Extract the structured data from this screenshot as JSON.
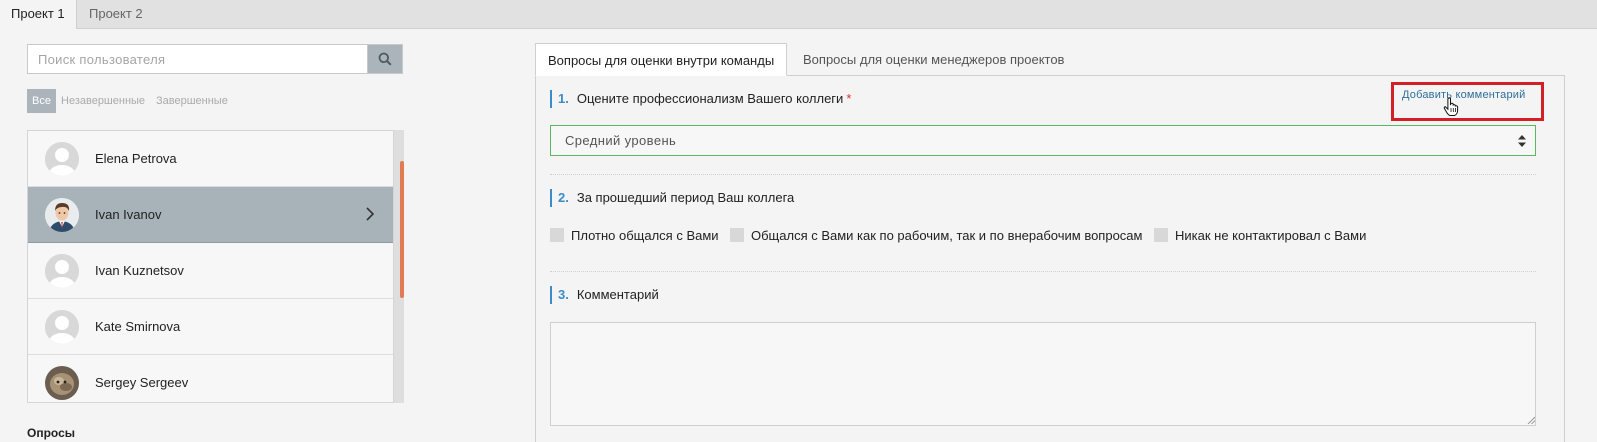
{
  "projects": {
    "tabs": [
      "Проект 1",
      "Проект 2"
    ],
    "active_index": 0
  },
  "search": {
    "placeholder": "Поиск пользователя",
    "value": "",
    "button_icon": "search-icon"
  },
  "filters": {
    "items": [
      "Все",
      "Незавершенные",
      "Завершенные"
    ],
    "active_index": 0
  },
  "users": [
    {
      "name": "Elena Petrova",
      "avatar": "default-avatar",
      "selected": false
    },
    {
      "name": "Ivan Ivanov",
      "avatar": "cartoon-man-avatar",
      "selected": true
    },
    {
      "name": "Ivan Kuznetsov",
      "avatar": "default-avatar",
      "selected": false
    },
    {
      "name": "Kate Smirnova",
      "avatar": "default-avatar",
      "selected": false
    },
    {
      "name": "Sergey Sergeev",
      "avatar": "photo-avatar",
      "selected": false
    }
  ],
  "left_section_title": "Опросы",
  "question_tabs": {
    "items": [
      "Вопросы для оценки внутри команды",
      "Вопросы для оценки менеджеров проектов"
    ],
    "active_index": 0
  },
  "questions": [
    {
      "number": "1.",
      "text": "Оцените профессионализм Вашего коллеги",
      "required": "*",
      "add_comment": "Добавить комментарий",
      "selected_option": "Средний уровень"
    },
    {
      "number": "2.",
      "text": "За прошедший период Ваш коллега",
      "options": [
        "Плотно общался с Вами",
        "Общался с Вами как по рабочим, так и по внерабочим вопросам",
        "Никак не контактировал с Вами"
      ]
    },
    {
      "number": "3.",
      "text": "Комментарий",
      "value": ""
    }
  ],
  "colors": {
    "accent": "#3a8dc8",
    "selected_row": "#a7b3b9",
    "scroll_thumb": "#e07b53",
    "highlight": "#d32027",
    "select_border": "#5cb85c"
  }
}
